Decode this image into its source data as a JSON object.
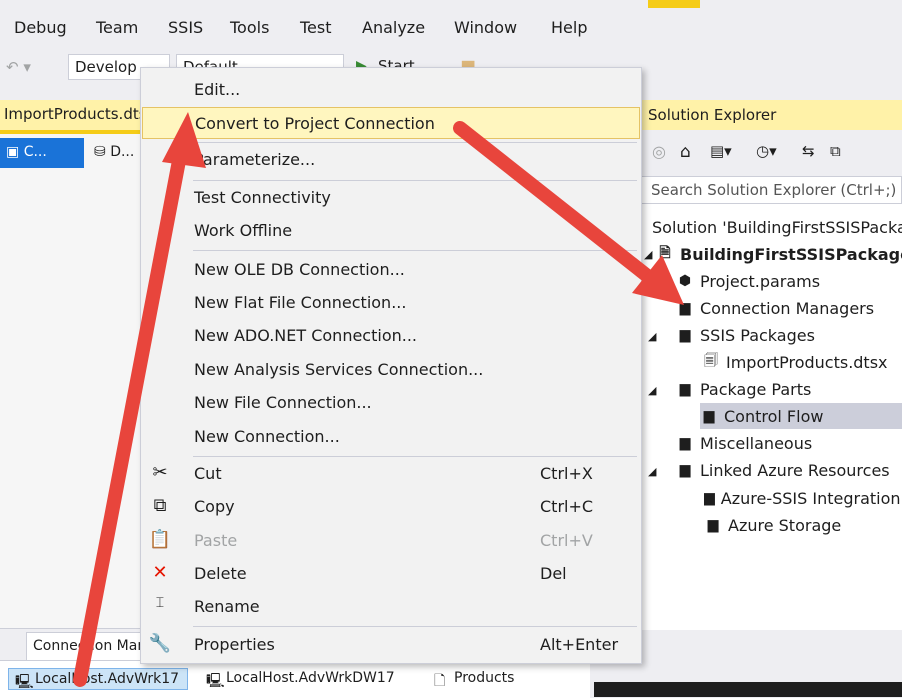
{
  "menubar": {
    "items": [
      "Debug",
      "Team",
      "SSIS",
      "Tools",
      "Test",
      "Analyze",
      "Window",
      "Help"
    ]
  },
  "toolbar": {
    "config_combo": "Develop",
    "platform_combo": "Default",
    "start_label": "Start"
  },
  "document": {
    "tab_label": "ImportProducts.dtsx",
    "subtab_active": "C...",
    "subtab_2": "D..."
  },
  "connection_managers": {
    "tab_label": "Connection Managers",
    "items": [
      "LocalHost.AdvWrk17",
      "LocalHost.AdvWrkDW17",
      "Products"
    ]
  },
  "solution_explorer": {
    "header": "Solution Explorer",
    "search_placeholder": "Search Solution Explorer (Ctrl+;)",
    "tree": [
      {
        "label": "Solution 'BuildingFirstSSISPackage'",
        "bold": false
      },
      {
        "label": "BuildingFirstSSISPackage",
        "bold": true
      },
      {
        "label": "Project.params",
        "bold": false
      },
      {
        "label": "Connection Managers",
        "bold": false
      },
      {
        "label": "SSIS Packages",
        "bold": false
      },
      {
        "label": "ImportProducts.dtsx",
        "bold": false
      },
      {
        "label": "Package Parts",
        "bold": false
      },
      {
        "label": "Control Flow",
        "bold": false
      },
      {
        "label": "Miscellaneous",
        "bold": false
      },
      {
        "label": "Linked Azure Resources",
        "bold": false
      },
      {
        "label": "Azure-SSIS Integration Runtime",
        "bold": false
      },
      {
        "label": "Azure Storage",
        "bold": false
      }
    ]
  },
  "context_menu": {
    "items": [
      {
        "label": "Edit...",
        "shortcut": ""
      },
      {
        "label": "Convert to Project Connection",
        "shortcut": ""
      },
      {
        "label": "Parameterize...",
        "shortcut": ""
      },
      {
        "label": "Test Connectivity",
        "shortcut": ""
      },
      {
        "label": "Work Offline",
        "shortcut": ""
      },
      {
        "label": "New OLE DB Connection...",
        "shortcut": ""
      },
      {
        "label": "New Flat File Connection...",
        "shortcut": ""
      },
      {
        "label": "New ADO.NET Connection...",
        "shortcut": ""
      },
      {
        "label": "New Analysis Services Connection...",
        "shortcut": ""
      },
      {
        "label": "New File Connection...",
        "shortcut": ""
      },
      {
        "label": "New Connection...",
        "shortcut": ""
      },
      {
        "label": "Cut",
        "shortcut": "Ctrl+X"
      },
      {
        "label": "Copy",
        "shortcut": "Ctrl+C"
      },
      {
        "label": "Paste",
        "shortcut": "Ctrl+V"
      },
      {
        "label": "Delete",
        "shortcut": "Del"
      },
      {
        "label": "Rename",
        "shortcut": ""
      },
      {
        "label": "Properties",
        "shortcut": "Alt+Enter"
      }
    ]
  },
  "colors": {
    "accent": "#f5cc17",
    "highlight": "#fff6bf",
    "arrow": "#e8453c",
    "delete_icon": "#e51400",
    "selection": "#1a73d8"
  },
  "icons": [
    "undo-icon",
    "start-icon",
    "folder-icon",
    "home-icon",
    "sync-icon",
    "cut-icon",
    "copy-icon",
    "paste-icon",
    "delete-icon",
    "rename-icon",
    "properties-icon",
    "connection-icon",
    "package-icon",
    "folder-icon",
    "params-icon"
  ]
}
